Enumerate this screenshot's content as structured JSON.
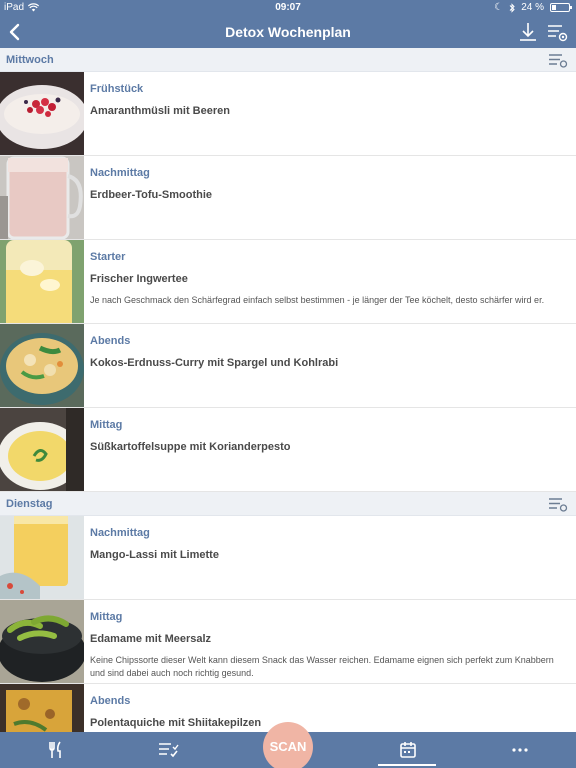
{
  "status": {
    "device": "iPad",
    "time": "09:07",
    "battery": "24 %",
    "battery_level": 0.24
  },
  "nav": {
    "title": "Detox Wochenplan",
    "back_icon": "chevron-left-icon",
    "download_icon": "download-icon",
    "settings_icon": "list-settings-icon"
  },
  "sections": [
    {
      "day": "Mittwoch",
      "items": [
        {
          "meal": "Frühstück",
          "dish": "Amaranthmüsli mit Beeren",
          "desc": ""
        },
        {
          "meal": "Nachmittag",
          "dish": "Erdbeer-Tofu-Smoothie",
          "desc": ""
        },
        {
          "meal": "Starter",
          "dish": "Frischer Ingwertee",
          "desc": "Je nach Geschmack den Schärfegrad einfach selbst bestimmen - je länger der Tee köchelt, desto schärfer wird er."
        },
        {
          "meal": "Abends",
          "dish": "Kokos-Erdnuss-Curry mit Spargel und Kohlrabi",
          "desc": ""
        },
        {
          "meal": "Mittag",
          "dish": "Süßkartoffelsuppe mit Korianderpesto",
          "desc": ""
        }
      ]
    },
    {
      "day": "Dienstag",
      "items": [
        {
          "meal": "Nachmittag",
          "dish": "Mango-Lassi mit Limette",
          "desc": ""
        },
        {
          "meal": "Mittag",
          "dish": "Edamame mit Meersalz",
          "desc": "Keine Chipssorte dieser Welt kann diesem Snack das Wasser reichen. Edamame eignen sich perfekt zum Knabbern und sind dabei auch noch richtig gesund."
        },
        {
          "meal": "Abends",
          "dish": "Polentaquiche mit Shiitakepilzen",
          "desc": ""
        }
      ]
    }
  ],
  "tabbar": {
    "recipes_icon": "fork-knife-icon",
    "shopping_icon": "checklist-icon",
    "scan_label": "SCAN",
    "plan_icon": "calendar-icon",
    "more_icon": "more-dots-icon"
  },
  "colors": {
    "primary": "#5c7aa5",
    "scan": "#f0b5a5",
    "section_bg": "#eef1f5"
  }
}
